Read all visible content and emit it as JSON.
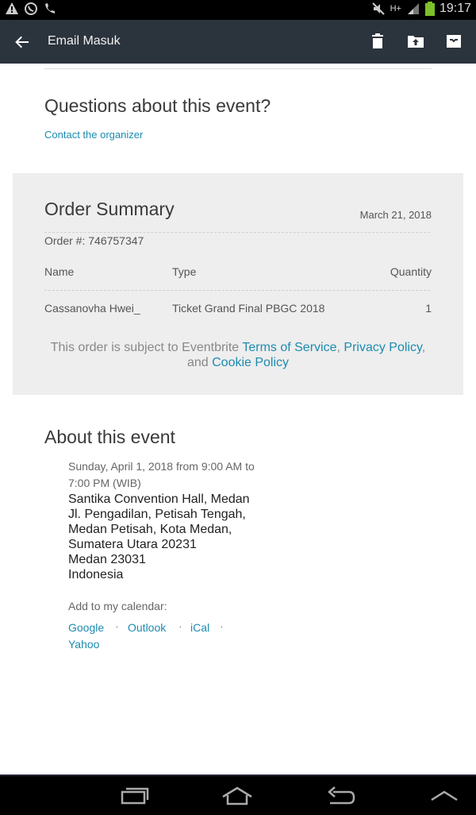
{
  "status_bar": {
    "time": "19:17",
    "network": "H+",
    "left_icons": [
      "warning-icon",
      "whatsapp-icon",
      "phone-icon"
    ],
    "right_icons": [
      "mute-icon",
      "signal-icon",
      "battery-icon"
    ]
  },
  "app_bar": {
    "title": "Email Masuk",
    "actions": [
      "delete-icon",
      "move-to-folder-icon",
      "archive-icon"
    ]
  },
  "questions": {
    "title": "Questions about this event?",
    "contact_link": "Contact the organizer"
  },
  "order_summary": {
    "title": "Order Summary",
    "date": "March 21, 2018",
    "order_number": "Order #: 746757347",
    "columns": [
      "Name",
      "Type",
      "Quantity"
    ],
    "rows": [
      [
        "Cassanovha Hwei_",
        "Ticket Grand Final PBGC 2018",
        "1"
      ]
    ],
    "policy": {
      "prefix": "This order is subject to Eventbrite",
      "terms": "Terms of Service",
      "comma1": ",",
      "privacy": "Privacy Policy",
      "comma2": ",",
      "and": "and",
      "cookie": "Cookie Policy"
    }
  },
  "about": {
    "title": "About this event",
    "when": "Sunday, April 1, 2018 from 9:00 AM to 7:00 PM (WIB)",
    "address_lines": [
      "Santika Convention Hall, Medan",
      "Jl. Pengadilan, Petisah Tengah,",
      "Medan Petisah, Kota Medan,",
      "Sumatera Utara 20231",
      "Medan 23031",
      "Indonesia"
    ],
    "calendar_label": "Add to my calendar:",
    "calendars": [
      "Google",
      "Outlook",
      "iCal",
      "Yahoo"
    ],
    "separator": "·"
  },
  "nav_bar": {
    "buttons": [
      "recent-apps-icon",
      "home-icon",
      "back-icon",
      "chevron-up-icon"
    ]
  },
  "colors": {
    "app_bar": "#2b333d",
    "link": "#1c8bb0",
    "summary_bg": "#eeeeee"
  }
}
